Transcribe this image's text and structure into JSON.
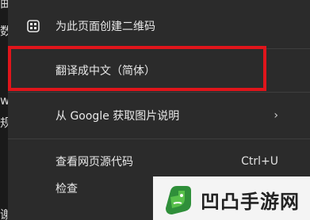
{
  "background_fragments": [
    "曲",
    "数",
    "w",
    "规",
    "谢潮"
  ],
  "menu": {
    "items": [
      {
        "label": "为此页面创建二维码",
        "icon": "qr-code-icon"
      },
      {
        "label": "翻译成中文（简体）"
      },
      {
        "label": "从 Google 获取图片说明",
        "submenu_indicator": "chevron-right-icon"
      },
      {
        "label": "查看网页源代码",
        "shortcut": "Ctrl+U"
      },
      {
        "label": "检查"
      }
    ]
  },
  "watermark": {
    "text": "凹凸手游网",
    "logo": "green-fist-logo"
  },
  "colors": {
    "menu_bg": "#2b2b2b",
    "highlight": "#e0151b",
    "text": "#e8e8e8"
  }
}
